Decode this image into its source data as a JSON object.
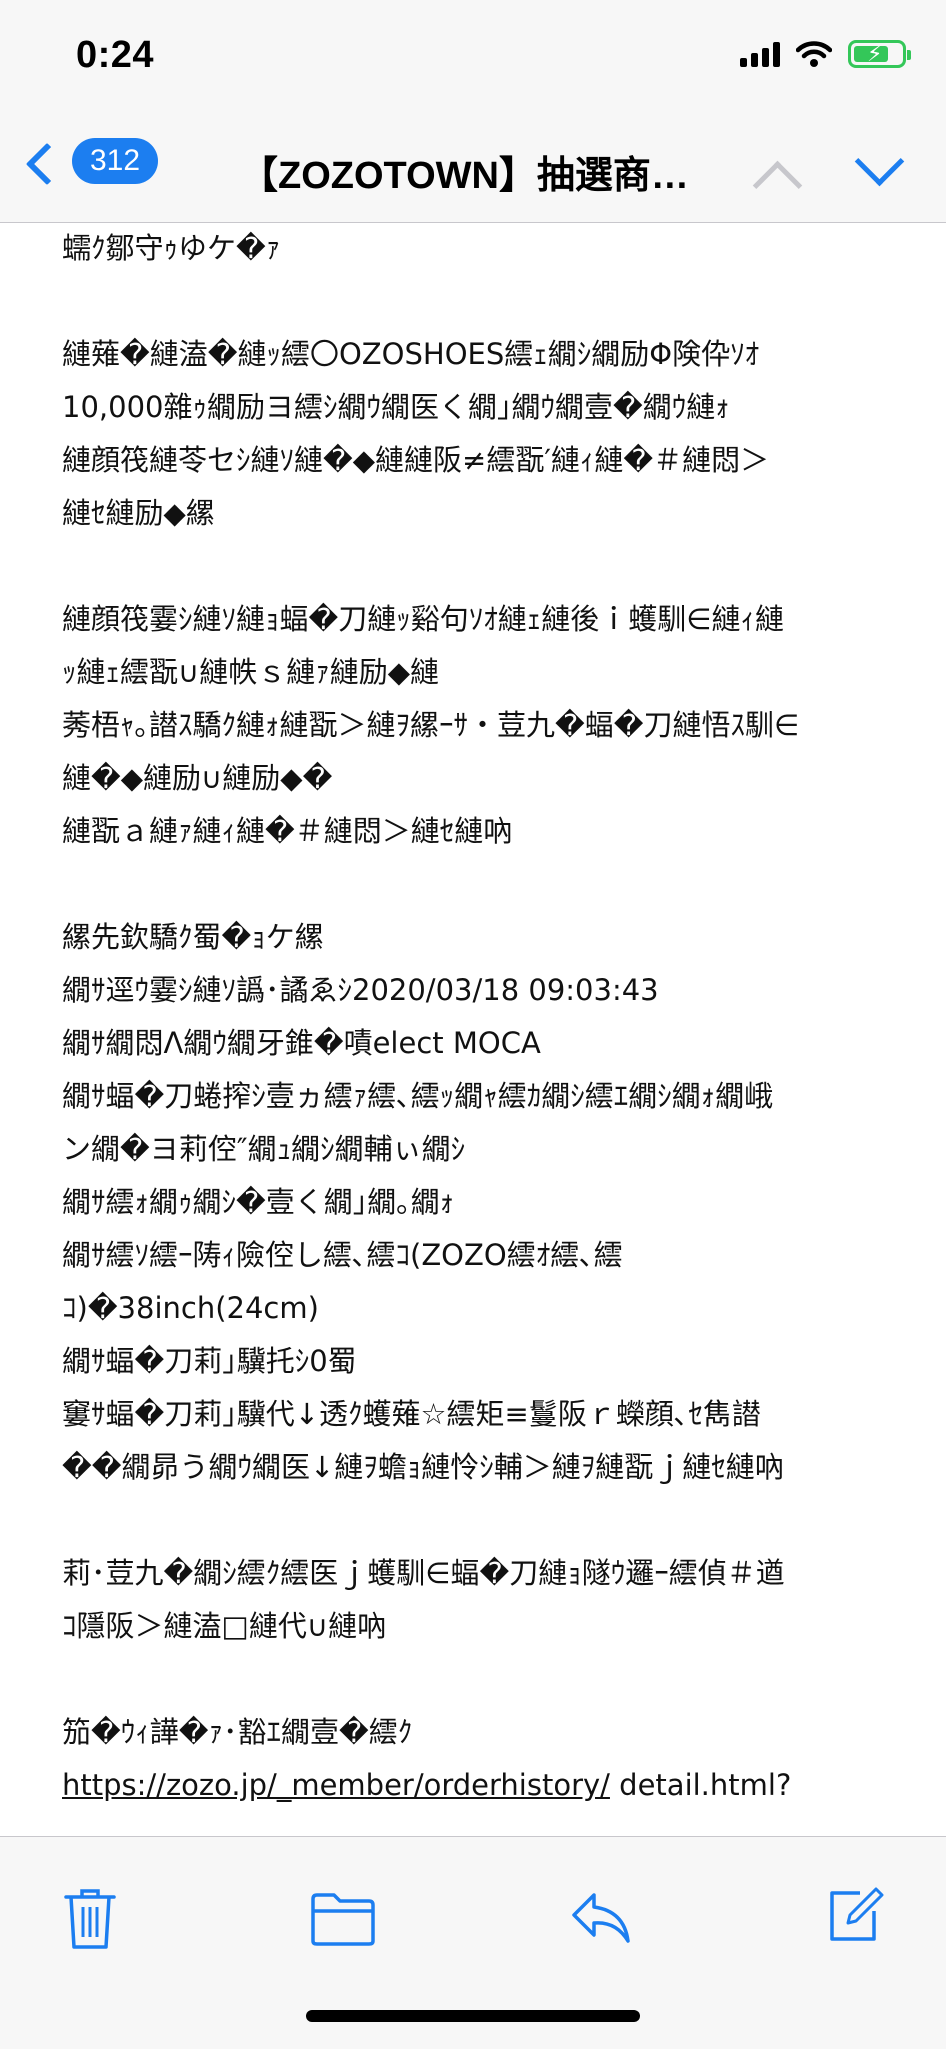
{
  "status": {
    "time": "0:24"
  },
  "nav": {
    "badge_count": "312",
    "title": "【ZOZOTOWN】抽選商…",
    "accent": "#1c7ef0"
  },
  "mail": {
    "lines": [
      "蠕ｸ鄒守ｩゆケ�ｧ",
      "",
      "縺薙�縺溘�縺ｯ繧〇OZOSHOES繧ｪ繝ｼ繝励Φ険伜ｿｵ",
      "10,000雜ｩ繝励ヨ繧ｼ繝ｳ繝医く繝｣繝ｳ繝壹�繝ｳ縺ｫ",
      "縺顔筏縺苓セｼ縺ｿ縺�◆縺縺阪≠繧翫′縺ｨ縺�＃縺悶＞",
      "縺ｾ縺励◆縲",
      "",
      "縺顔筏霎ｼ縺ｿ縺ｮ蝠�刀縺ｯ谿句ｿｵ縺ｪ縺後ｉ蠖馴∈縺ｨ縺",
      "ｯ縺ｪ繧翫∪縺帙ｓ縺ｧ縺励◆縺",
      "莠梧ｬ｡譛ｽ驕ｸ縺ｫ縺翫＞縺ｦ縲ｰｻ・荳九�蝠�刀縺悟ｽ馴∈",
      "縺�◆縺励∪縺励◆�",
      "縺翫ａ縺ｧ縺ｨ縺�＃縺悶＞縺ｾ縺吶",
      "",
      "縲先欽驕ｸ蜀�ｮケ縲",
      "繝ｻ逕ｳ霎ｼ縺ｿ譌･譎ゑｼ2020/03/18 09:03:43",
      "繝ｻ繝悶Λ繝ｳ繝牙錐�嘖elect MOCA",
      "繝ｻ蝠�刀蜷搾ｼ壹ヵ繧ｧ繧､繧ｯ繝ｬ繧ｶ繝ｼ繧ｴ繝ｼ繝ｫ繝峨",
      "ン繝�ヨ莉倥″繝ｭ繝ｼ繝輔ぃ繝ｼ",
      "繝ｻ繧ｫ繝ｩ繝ｼ�壹く繝｣繝｡繝ｫ",
      "繝ｻ繧ｿ繧ｰ陦ｨ險倥し繧､繧ｺ(ZOZO繧ｵ繧､繧",
      "ｺ)�38inch(24cm)",
      "繝ｻ蝠�刀莉｣驥托ｼ0蜀",
      "窶ｻ蝠�刀莉｣驥代↓透ｸ蠖薙☆繧矩≡鬘阪ｒ蠑顔､ｾ雋譛",
      "��繝昴う繝ｳ繝医↓縺ｦ蟾ｮ縺怜ｼ輔＞縺ｦ縺翫ｊ縺ｾ縺吶",
      "",
      "莉･荳九�繝ｼ繧ｸ繧医ｊ蠖馴∈蝠�刀縺ｮ隧ｳ邏ｰ繧偵＃遒",
      "ｺ隱阪＞縺溘□縺代∪縺吶",
      "",
      "笳�ｳｨ譁�ｧ･豁ｴ繝壹�繧ｸ"
    ],
    "link_text": "https://zozo.jp/_member/orderhistory/",
    "link_tail": " detail.html?"
  },
  "toolbar": {
    "trash": "trash-icon",
    "folder": "folder-icon",
    "reply": "reply-icon",
    "compose": "compose-icon"
  }
}
